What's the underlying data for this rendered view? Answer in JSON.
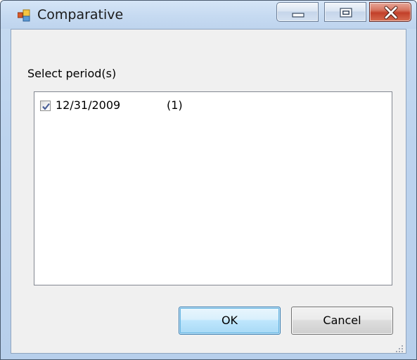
{
  "window": {
    "title": "Comparative"
  },
  "dialog": {
    "prompt": "Select period(s)",
    "periods": [
      {
        "date": "12/31/2009",
        "count": "(1)",
        "checked": true
      }
    ]
  },
  "buttons": {
    "ok": "OK",
    "cancel": "Cancel"
  },
  "colors": {
    "title_bar": "#c6daf1",
    "client_bg": "#f0f0f0",
    "close_button": "#c2402a",
    "ok_border": "#3c7fb1"
  },
  "icons": {
    "app": "app-window-icon",
    "minimize": "minimize-icon",
    "maximize": "maximize-icon",
    "close": "close-icon",
    "check": "checkmark-icon",
    "grip": "resize-grip-icon"
  }
}
